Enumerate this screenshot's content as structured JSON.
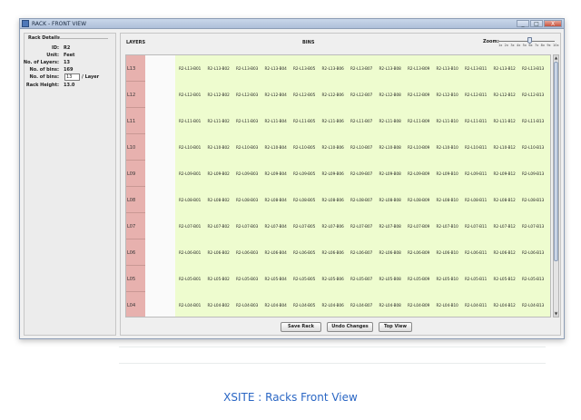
{
  "window": {
    "title": "RACK - FRONT VIEW",
    "buttons": [
      "_",
      "□",
      "X"
    ]
  },
  "rack_details": {
    "legend": "Rack Details",
    "fields": [
      {
        "label": "ID:",
        "value": "R2"
      },
      {
        "label": "Unit:",
        "value": "Feet"
      },
      {
        "label": "No. of Layers:",
        "value": "13"
      },
      {
        "label": "No. of bins:",
        "value": "169"
      }
    ],
    "bins_per_layer": {
      "label": "No. of bins:",
      "value": "13",
      "unit": "/ Layer"
    },
    "rack_height": {
      "label": "Rack Height:",
      "value": "13.0"
    }
  },
  "headers": {
    "layers": "LAYERS",
    "bins": "BINS"
  },
  "zoom": {
    "label": "Zoom:",
    "ticks": [
      "1x",
      "2x",
      "3x",
      "4x",
      "5x",
      "6x",
      "7x",
      "8x",
      "9x",
      "10x"
    ],
    "value": 6
  },
  "layers": [
    "L13",
    "L12",
    "L11",
    "L10",
    "L09",
    "L08",
    "L07",
    "L06",
    "L05",
    "L04"
  ],
  "rack_id": "R2",
  "bins_per_row": 13,
  "buttons": {
    "save": "Save Rack",
    "undo": "Undo Changes",
    "top": "Top View"
  },
  "caption": "XSITE : Racks Front View"
}
